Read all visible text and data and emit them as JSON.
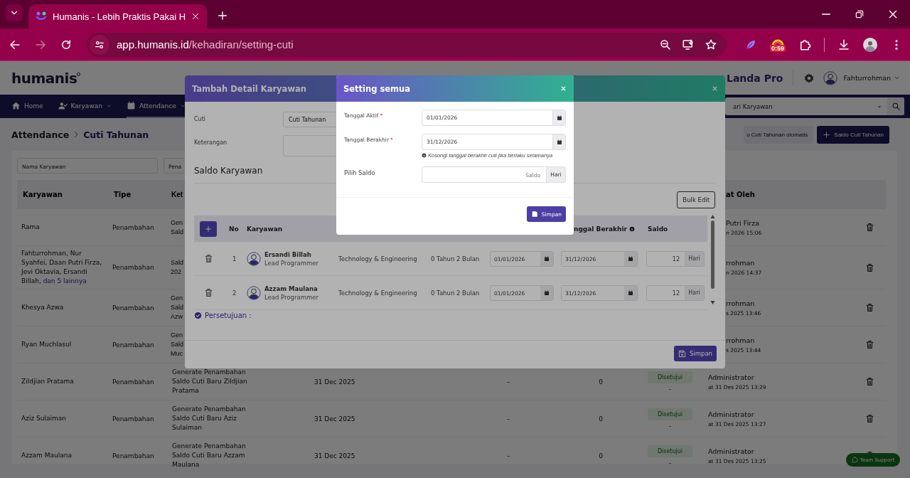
{
  "browser": {
    "tab": {
      "title": "Humanis - Lebih Praktis Pakai H"
    },
    "address": {
      "host": "app.humanis.id",
      "path": "/kehadiran/setting-cuti"
    },
    "extension_badge": "0:59"
  },
  "header": {
    "logo": "humanis",
    "company": "Landa Pro",
    "user": "Fahturrohman"
  },
  "nav": {
    "items": [
      {
        "label": "Home",
        "selected": false,
        "dropdown": false
      },
      {
        "label": "Karyawan",
        "selected": false,
        "dropdown": true
      },
      {
        "label": "Attendance",
        "selected": true,
        "dropdown": true
      }
    ],
    "search": {
      "placeholder": "ari Karyawan"
    }
  },
  "breadcrumb": [
    "Attendance",
    "Cuti Tahunan"
  ],
  "actions": [
    {
      "kind": "secondary",
      "label": "o Cuti Tahunan otomatis"
    },
    {
      "kind": "primary",
      "label": "Saldo Cuti Tahunan"
    }
  ],
  "filters": [
    {
      "placeholder": "Nama Karyawan"
    },
    {
      "placeholder": "Pena"
    }
  ],
  "table": {
    "columns": [
      "Karyawan",
      "Tipe",
      "Ket",
      "at Oleh"
    ],
    "rows": [
      {
        "kind": "covered",
        "employee": "Rama",
        "type": "Penambahan",
        "description": "Gen Sald",
        "created_by": "Putri Firza",
        "created_at": "n 2026 15:06"
      },
      {
        "kind": "covered",
        "employee": "Fahturrohman, Nur Syahfei, Daan Putri Firza, Jevi Oktavia, Ersandi Billah,",
        "more_link": "dan 5 lainnya",
        "type": "Penambahan",
        "description": "Sald 202",
        "created_by": "rrohman",
        "created_at": "n 2026 14:37"
      },
      {
        "kind": "covered",
        "employee": "Khesya Azwa",
        "type": "Penambahan",
        "description": "Gen Sald Azw",
        "created_by": "rrohman",
        "created_at": "s 2025 13:46"
      },
      {
        "kind": "covered",
        "employee": "Ryan Muchlasul",
        "type": "Penambahan",
        "description": "Gen Sald Muc",
        "created_by": "rrohman",
        "created_at": "s 2025 13:44"
      },
      {
        "kind": "full",
        "employee": "Zildjian Pratama",
        "type": "Penambahan",
        "description": "Generate Penambahan Saldo Cuti Baru Zildjian Pratama",
        "date": "31 Dec 2025",
        "column_5": "–",
        "balance": "0",
        "status": "Disetujui",
        "status_note": "-",
        "created_by": "Administrator",
        "created_at": "at 31 Des 2025 13:29"
      },
      {
        "kind": "full",
        "employee": "Aziz Sulaiman",
        "type": "Penambahan",
        "description": "Generate Penambahan Saldo Cuti Baru Aziz Sulaiman",
        "date": "31 Dec 2025",
        "column_5": "–",
        "balance": "0",
        "status": "Disetujui",
        "status_note": "-",
        "created_by": "Administrator",
        "created_at": "at 31 Des 2025 13:27"
      },
      {
        "kind": "full",
        "employee": "Azzam Maulana",
        "type": "Penambahan",
        "description": "Generate Penambahan Saldo Cuti Baru Azzam Maulana",
        "date": "31 Dec 2025",
        "column_5": "–",
        "balance": "0",
        "status": "Disetujui",
        "status_note": "-",
        "created_by": "Administrator",
        "created_at": "at 31 Des 2025 13:25"
      }
    ]
  },
  "support_button": "Team Support",
  "detail_modal": {
    "title": "Tambah Detail Karyawan",
    "fields": [
      {
        "kind": "select",
        "label": "Cuti",
        "value": "Cuti Tahunan"
      },
      {
        "kind": "textarea",
        "label": "Keterangan"
      }
    ],
    "section_title": "Saldo Karyawan",
    "bulk_edit": "Bulk Edit",
    "columns": [
      "No",
      "Karyawan",
      "nggal Berakhir",
      "Saldo"
    ],
    "rows": [
      {
        "no": "1",
        "name": "Ersandi Billah",
        "role": "Lead Programmer",
        "department": "Technology & Engineering",
        "tenure": "0 Tahun 2 Bulan",
        "start": "01/01/2026",
        "end": "31/12/2026",
        "balance": "12",
        "unit": "Hari"
      },
      {
        "no": "2",
        "name": "Azzam Maulana",
        "role": "Lead Programmer",
        "department": "Technology & Engineering",
        "tenure": "0 Tahun 2 Bulan",
        "start": "01/01/2026",
        "end": "31/12/2026",
        "balance": "12",
        "unit": "Hari"
      }
    ],
    "approval": "Persetujuan :",
    "save": "Simpan"
  },
  "setting_modal": {
    "title": "Setting semua",
    "fields": [
      {
        "kind": "date",
        "label": "Tanggal Aktif",
        "required_mark": "*",
        "value": "01/01/2026"
      },
      {
        "kind": "date",
        "label": "Tanggal Berakhir",
        "required_mark": "*",
        "value": "31/12/2026",
        "hint": "Kosongi tanggal berakhir cuti jika berlaku selamanya"
      },
      {
        "kind": "number",
        "label": "Pilih Saldo",
        "placeholder": "Saldo",
        "unit": "Hari"
      }
    ],
    "save": "Simpan"
  }
}
